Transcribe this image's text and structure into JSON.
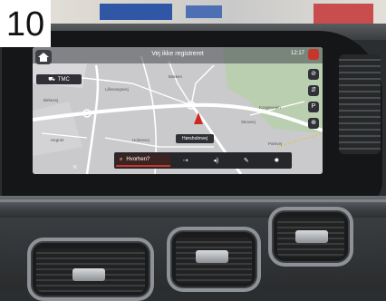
{
  "tag": {
    "number": "10"
  },
  "status_bar": {
    "title": "Vej ikke registreret",
    "time": "12:17"
  },
  "buttons": {
    "home_icon": "house-icon",
    "tmc_label": "TMC",
    "tmc_icon": "traffic-icon",
    "right_rail": [
      {
        "icon": "compass-icon",
        "glyph": "⊘"
      },
      {
        "icon": "traffic-lights-icon",
        "glyph": "⇵"
      },
      {
        "icon": "parking-icon",
        "glyph": "P"
      },
      {
        "icon": "zoom-icon",
        "glyph": "⊕"
      }
    ]
  },
  "map": {
    "street_chip": "Hørsholmvej",
    "labels": [
      "Lillevangsvej",
      "Birkevej",
      "Holmevej",
      "Skovvej",
      "Kongevejen",
      "Bakken",
      "Hegnet",
      "Parkvej"
    ],
    "compass_text": "N"
  },
  "bottom_bar": {
    "search_text": "Hvorhen?",
    "search_icon": "magnifier-icon",
    "buttons": [
      {
        "icon": "route-icon",
        "glyph": "⇢"
      },
      {
        "icon": "volume-icon",
        "glyph": "◂)"
      },
      {
        "icon": "destination-icon",
        "glyph": "✎"
      },
      {
        "icon": "settings-icon",
        "glyph": "✹"
      }
    ]
  },
  "colors": {
    "accent": "#c7362b",
    "marker": "#d0281f",
    "map_base": "#c8c8cb",
    "park": "#b9cfb0"
  }
}
